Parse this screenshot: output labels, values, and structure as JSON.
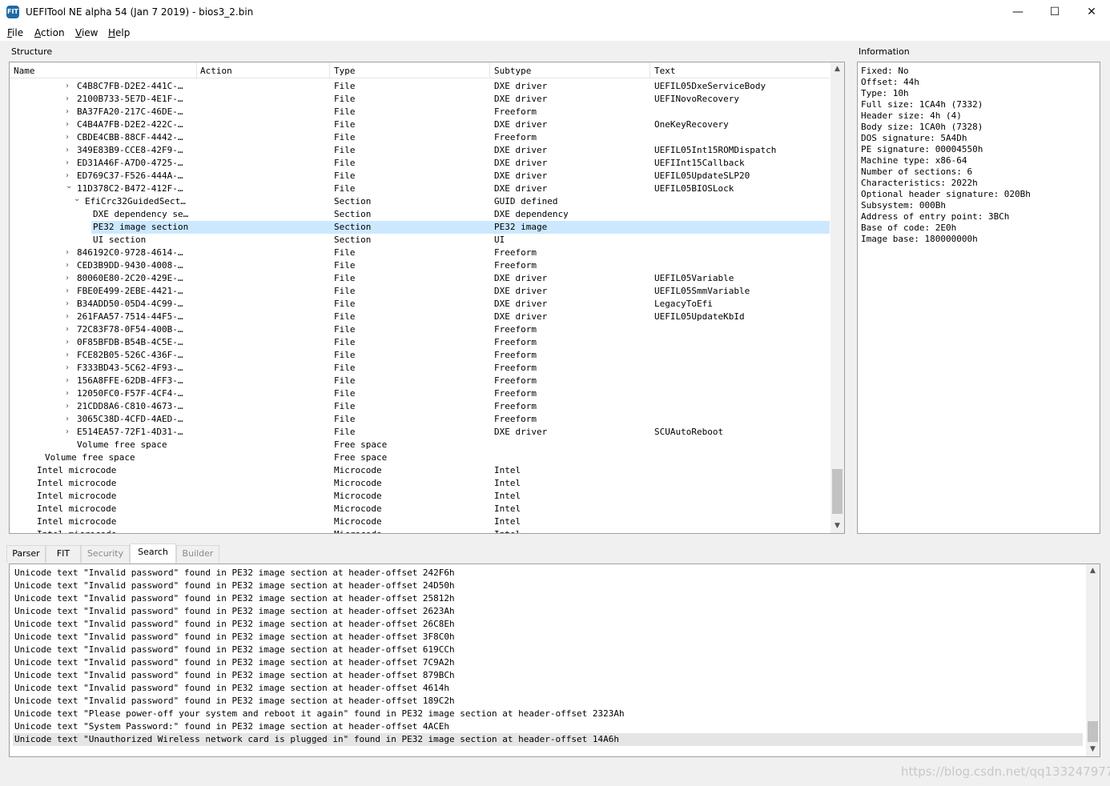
{
  "window": {
    "title": "UEFITool NE alpha 54 (Jan  7 2019) - bios3_2.bin",
    "icon_text": "FIT",
    "minimize": "—",
    "maximize": "☐",
    "close": "✕"
  },
  "menu": [
    "File",
    "Action",
    "View",
    "Help"
  ],
  "structure": {
    "label": "Structure",
    "columns": [
      "Name",
      "Action",
      "Type",
      "Subtype",
      "Text"
    ],
    "rows": [
      {
        "name": "C4B8C7FB-D2E2-441C-…",
        "action": "",
        "type": "File",
        "subtype": "DXE driver",
        "text": "UEFIL05DxeServiceBody",
        "indent": 80,
        "arrow": "closed"
      },
      {
        "name": "2100B733-5E7D-4E1F-…",
        "action": "",
        "type": "File",
        "subtype": "DXE driver",
        "text": "UEFINovoRecovery",
        "indent": 80,
        "arrow": "closed"
      },
      {
        "name": "BA37FA20-217C-46DE-…",
        "action": "",
        "type": "File",
        "subtype": "Freeform",
        "text": "",
        "indent": 80,
        "arrow": "closed"
      },
      {
        "name": "C4B4A7FB-D2E2-422C-…",
        "action": "",
        "type": "File",
        "subtype": "DXE driver",
        "text": "OneKeyRecovery",
        "indent": 80,
        "arrow": "closed"
      },
      {
        "name": "CBDE4CBB-88CF-4442-…",
        "action": "",
        "type": "File",
        "subtype": "Freeform",
        "text": "",
        "indent": 80,
        "arrow": "closed"
      },
      {
        "name": "349E83B9-CCE8-42F9-…",
        "action": "",
        "type": "File",
        "subtype": "DXE driver",
        "text": "UEFIL05Int15ROMDispatch",
        "indent": 80,
        "arrow": "closed"
      },
      {
        "name": "ED31A46F-A7D0-4725-…",
        "action": "",
        "type": "File",
        "subtype": "DXE driver",
        "text": "UEFIInt15Callback",
        "indent": 80,
        "arrow": "closed"
      },
      {
        "name": "ED769C37-F526-444A-…",
        "action": "",
        "type": "File",
        "subtype": "DXE driver",
        "text": "UEFIL05UpdateSLP20",
        "indent": 80,
        "arrow": "closed"
      },
      {
        "name": "11D378C2-B472-412F-…",
        "action": "",
        "type": "File",
        "subtype": "DXE driver",
        "text": "UEFIL05BIOSLock",
        "indent": 80,
        "arrow": "open"
      },
      {
        "name": "EfiCrc32GuidedSect…",
        "action": "",
        "type": "Section",
        "subtype": "GUID defined",
        "text": "",
        "indent": 90,
        "arrow": "open"
      },
      {
        "name": "DXE dependency se…",
        "action": "",
        "type": "Section",
        "subtype": "DXE dependency",
        "text": "",
        "indent": 100,
        "arrow": "none"
      },
      {
        "name": "PE32 image section",
        "action": "",
        "type": "Section",
        "subtype": "PE32 image",
        "text": "",
        "indent": 100,
        "arrow": "none",
        "selected": true
      },
      {
        "name": "UI section",
        "action": "",
        "type": "Section",
        "subtype": "UI",
        "text": "",
        "indent": 100,
        "arrow": "none"
      },
      {
        "name": "846192C0-9728-4614-…",
        "action": "",
        "type": "File",
        "subtype": "Freeform",
        "text": "",
        "indent": 80,
        "arrow": "closed"
      },
      {
        "name": "CED3B9DD-9430-4008-…",
        "action": "",
        "type": "File",
        "subtype": "Freeform",
        "text": "",
        "indent": 80,
        "arrow": "closed"
      },
      {
        "name": "80060E80-2C20-429E-…",
        "action": "",
        "type": "File",
        "subtype": "DXE driver",
        "text": "UEFIL05Variable",
        "indent": 80,
        "arrow": "closed"
      },
      {
        "name": "FBE0E499-2EBE-4421-…",
        "action": "",
        "type": "File",
        "subtype": "DXE driver",
        "text": "UEFIL05SmmVariable",
        "indent": 80,
        "arrow": "closed"
      },
      {
        "name": "B34ADD50-05D4-4C99-…",
        "action": "",
        "type": "File",
        "subtype": "DXE driver",
        "text": "LegacyToEfi",
        "indent": 80,
        "arrow": "closed"
      },
      {
        "name": "261FAA57-7514-44F5-…",
        "action": "",
        "type": "File",
        "subtype": "DXE driver",
        "text": "UEFIL05UpdateKbId",
        "indent": 80,
        "arrow": "closed"
      },
      {
        "name": "72C83F78-0F54-400B-…",
        "action": "",
        "type": "File",
        "subtype": "Freeform",
        "text": "",
        "indent": 80,
        "arrow": "closed"
      },
      {
        "name": "0F85BFDB-B54B-4C5E-…",
        "action": "",
        "type": "File",
        "subtype": "Freeform",
        "text": "",
        "indent": 80,
        "arrow": "closed"
      },
      {
        "name": "FCE82B05-526C-436F-…",
        "action": "",
        "type": "File",
        "subtype": "Freeform",
        "text": "",
        "indent": 80,
        "arrow": "closed"
      },
      {
        "name": "F333BD43-5C62-4F93-…",
        "action": "",
        "type": "File",
        "subtype": "Freeform",
        "text": "",
        "indent": 80,
        "arrow": "closed"
      },
      {
        "name": "156A8FFE-62DB-4FF3-…",
        "action": "",
        "type": "File",
        "subtype": "Freeform",
        "text": "",
        "indent": 80,
        "arrow": "closed"
      },
      {
        "name": "12050FC0-F57F-4CF4-…",
        "action": "",
        "type": "File",
        "subtype": "Freeform",
        "text": "",
        "indent": 80,
        "arrow": "closed"
      },
      {
        "name": "21CDD8A6-C810-4673-…",
        "action": "",
        "type": "File",
        "subtype": "Freeform",
        "text": "",
        "indent": 80,
        "arrow": "closed"
      },
      {
        "name": "3065C38D-4CFD-4AED-…",
        "action": "",
        "type": "File",
        "subtype": "Freeform",
        "text": "",
        "indent": 80,
        "arrow": "closed"
      },
      {
        "name": "E514EA57-72F1-4D31-…",
        "action": "",
        "type": "File",
        "subtype": "DXE driver",
        "text": "SCUAutoReboot",
        "indent": 80,
        "arrow": "closed"
      },
      {
        "name": "Volume free space",
        "action": "",
        "type": "Free space",
        "subtype": "",
        "text": "",
        "indent": 80,
        "arrow": "none"
      },
      {
        "name": "Volume free space",
        "action": "",
        "type": "Free space",
        "subtype": "",
        "text": "",
        "indent": 40,
        "arrow": "none"
      },
      {
        "name": "Intel microcode",
        "action": "",
        "type": "Microcode",
        "subtype": "Intel",
        "text": "",
        "indent": 30,
        "arrow": "none"
      },
      {
        "name": "Intel microcode",
        "action": "",
        "type": "Microcode",
        "subtype": "Intel",
        "text": "",
        "indent": 30,
        "arrow": "none"
      },
      {
        "name": "Intel microcode",
        "action": "",
        "type": "Microcode",
        "subtype": "Intel",
        "text": "",
        "indent": 30,
        "arrow": "none"
      },
      {
        "name": "Intel microcode",
        "action": "",
        "type": "Microcode",
        "subtype": "Intel",
        "text": "",
        "indent": 30,
        "arrow": "none"
      },
      {
        "name": "Intel microcode",
        "action": "",
        "type": "Microcode",
        "subtype": "Intel",
        "text": "",
        "indent": 30,
        "arrow": "none"
      },
      {
        "name": "Intel microcode",
        "action": "",
        "type": "Microcode",
        "subtype": "Intel",
        "text": "",
        "indent": 30,
        "arrow": "none"
      }
    ]
  },
  "information": {
    "label": "Information",
    "lines": [
      "Fixed: No",
      "Offset: 44h",
      "Type: 10h",
      "Full size: 1CA4h (7332)",
      "Header size: 4h (4)",
      "Body size: 1CA0h (7328)",
      "DOS signature: 5A4Dh",
      "PE signature: 00004550h",
      "Machine type: x86-64",
      "Number of sections: 6",
      "Characteristics: 2022h",
      "Optional header signature: 020Bh",
      "Subsystem: 000Bh",
      "Address of entry point: 3BCh",
      "Base of code: 2E0h",
      "Image base: 180000000h"
    ]
  },
  "tabs": [
    {
      "label": "Parser",
      "disabled": false,
      "active": false
    },
    {
      "label": "FIT",
      "disabled": false,
      "active": false
    },
    {
      "label": "Security",
      "disabled": true,
      "active": false
    },
    {
      "label": "Search",
      "disabled": false,
      "active": true
    },
    {
      "label": "Builder",
      "disabled": true,
      "active": false
    }
  ],
  "search_results": [
    "Unicode text \"Invalid password\" found in PE32 image section at header-offset 242F6h",
    "Unicode text \"Invalid password\" found in PE32 image section at header-offset 24D50h",
    "Unicode text \"Invalid password\" found in PE32 image section at header-offset 25812h",
    "Unicode text \"Invalid password\" found in PE32 image section at header-offset 2623Ah",
    "Unicode text \"Invalid password\" found in PE32 image section at header-offset 26C8Eh",
    "Unicode text \"Invalid password\" found in PE32 image section at header-offset 3F8C0h",
    "Unicode text \"Invalid password\" found in PE32 image section at header-offset 619CCh",
    "Unicode text \"Invalid password\" found in PE32 image section at header-offset 7C9A2h",
    "Unicode text \"Invalid password\" found in PE32 image section at header-offset 879BCh",
    "Unicode text \"Invalid password\" found in PE32 image section at header-offset 4614h",
    "Unicode text \"Invalid password\" found in PE32 image section at header-offset 189C2h",
    "Unicode text \"Please power-off your system and reboot it again\" found in PE32 image section at header-offset 2323Ah",
    "Unicode text \"System Password:\" found in PE32 image section at header-offset 4ACEh",
    "Unicode text \"Unauthorized Wireless network card is plugged in\" found in PE32 image section at header-offset 14A6h"
  ],
  "watermark": "https://blog.csdn.net/qq1332479771",
  "icons": {
    "collapsed": "›",
    "expanded": "⌄",
    "scroll_up": "▲",
    "scroll_down": "▼"
  }
}
